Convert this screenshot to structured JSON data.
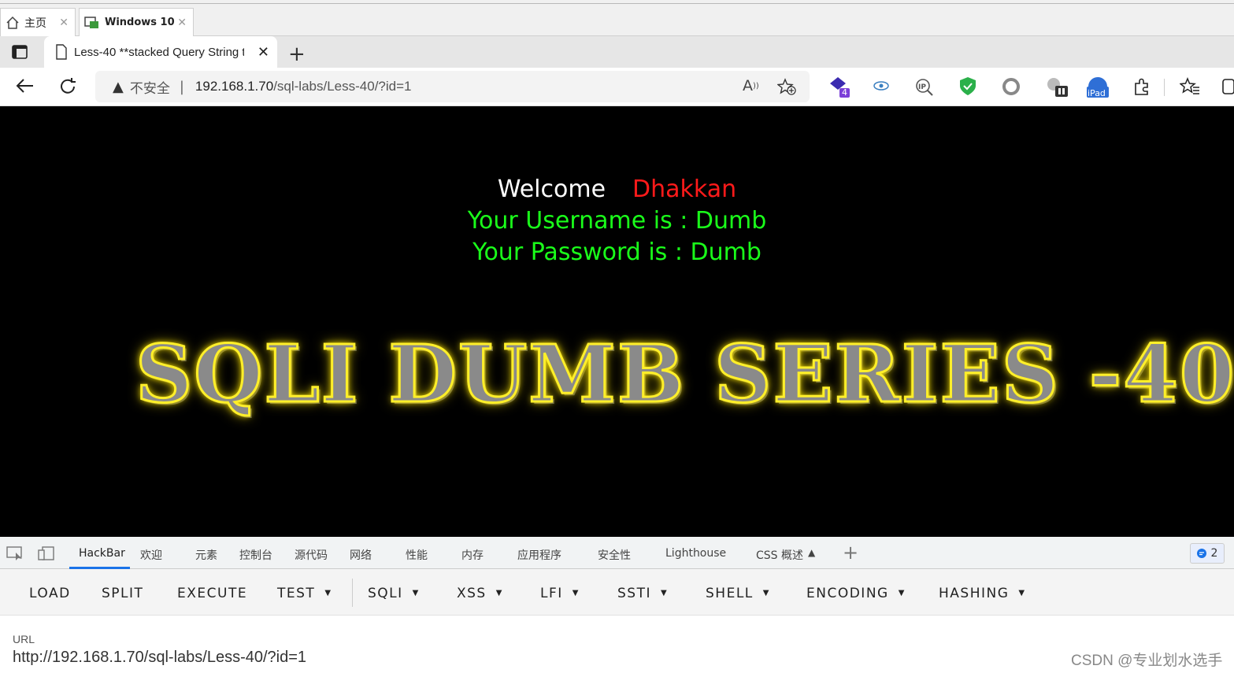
{
  "vm_tabs": [
    {
      "label": "主页",
      "icon": "home-icon"
    },
    {
      "label": "Windows 10",
      "icon": "vm-icon"
    }
  ],
  "browser": {
    "tab_title": "Less-40 **stacked Query String t",
    "insecure_label": "不安全",
    "url_host": "192.168.1.70",
    "url_path": "/sql-labs/Less-40/?id=1",
    "ext_badge": "4",
    "ipad_label": "iPad"
  },
  "page": {
    "welcome": "Welcome",
    "user": "Dhakkan",
    "username_line": "Your Username is : Dumb",
    "password_line": "Your Password is : Dumb",
    "banner": "SQLI DUMB SERIES -40"
  },
  "devtools": {
    "tabs": [
      "HackBar",
      "欢迎",
      "元素",
      "控制台",
      "源代码",
      "网络",
      "性能",
      "内存",
      "应用程序",
      "安全性",
      "Lighthouse",
      "CSS 概述"
    ],
    "issues_count": "2"
  },
  "hackbar": {
    "buttons": [
      "LOAD",
      "SPLIT",
      "EXECUTE",
      "TEST",
      "SQLI",
      "XSS",
      "LFI",
      "SSTI",
      "SHELL",
      "ENCODING",
      "HASHING"
    ],
    "url_label": "URL",
    "url_value": "http://192.168.1.70/sql-labs/Less-40/?id=1"
  },
  "watermark": "CSDN @专业划水选手",
  "colors": {
    "welcome": "#ffffff",
    "user": "#ff1a1a",
    "credentials": "#1aff1a",
    "banner_glow": "#ffef2a"
  }
}
